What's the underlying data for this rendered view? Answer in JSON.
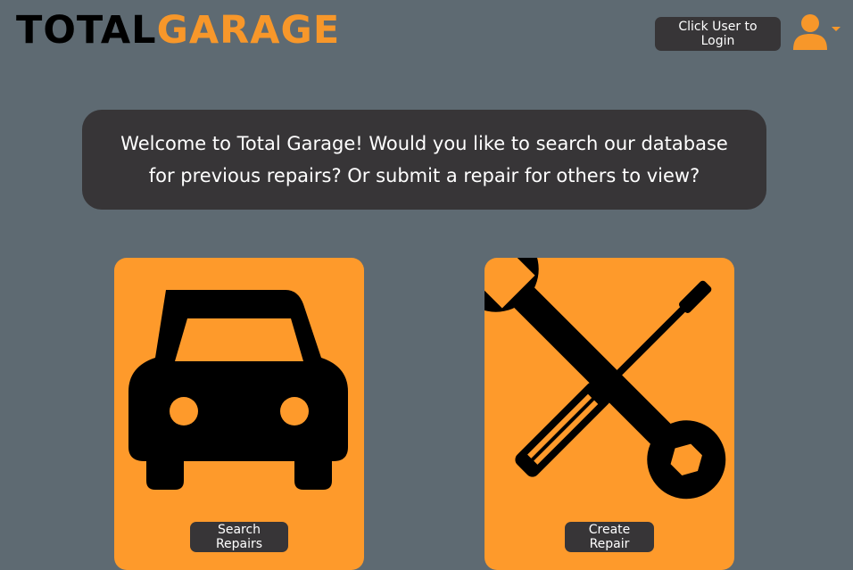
{
  "header": {
    "logo_part1": "TOTAL",
    "logo_part2": "GARAGE",
    "login_label": "Click User to Login",
    "user_icon": "user-icon"
  },
  "welcome": {
    "message": "Welcome to Total Garage! Would you like to search our database for previous repairs? Or submit a repair for others to view?"
  },
  "cards": [
    {
      "icon": "car-icon",
      "button_label": "Search Repairs"
    },
    {
      "icon": "tools-icon",
      "button_label": "Create Repair"
    }
  ],
  "colors": {
    "accent": "#f7972a",
    "card": "#fe9a2b",
    "dark": "#373537",
    "background": "#5e6a72"
  }
}
